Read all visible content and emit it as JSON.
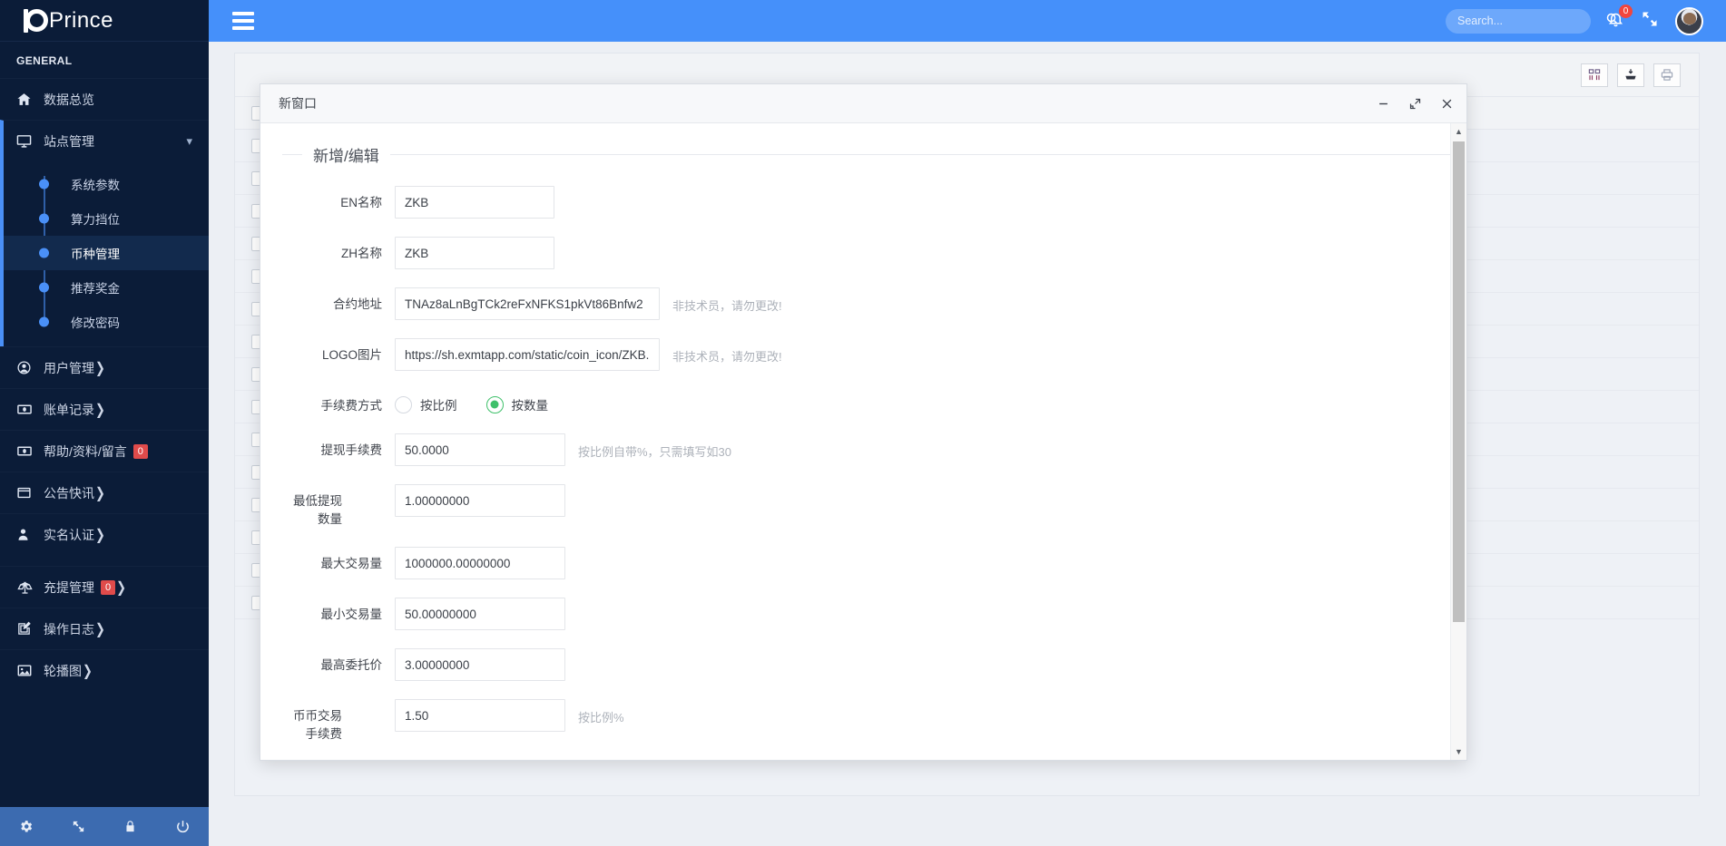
{
  "brand": {
    "name": "Prince",
    "logo_icon": "prince-logo-icon"
  },
  "sidebar": {
    "section_label": "GENERAL",
    "items": [
      {
        "label": "数据总览",
        "icon": "home-icon",
        "badge": null,
        "arrow": false
      },
      {
        "label": "站点管理",
        "icon": "monitor-icon",
        "badge": null,
        "arrow": false,
        "expanded": true
      },
      {
        "label": "用户管理",
        "icon": "user-circle-icon",
        "badge": null,
        "arrow": true
      },
      {
        "label": "账单记录",
        "icon": "banknote-icon",
        "badge": null,
        "arrow": true
      },
      {
        "label": "帮助/资料/留言",
        "icon": "banknote-icon",
        "badge": "0",
        "arrow": false
      },
      {
        "label": "公告快讯",
        "icon": "window-icon",
        "badge": null,
        "arrow": true
      },
      {
        "label": "实名认证",
        "icon": "person-icon",
        "badge": null,
        "arrow": true
      },
      {
        "label": "充提管理",
        "icon": "scales-icon",
        "badge": "0",
        "arrow": true
      },
      {
        "label": "操作日志",
        "icon": "edit-square-icon",
        "badge": null,
        "arrow": true
      },
      {
        "label": "轮播图",
        "icon": "image-icon",
        "badge": null,
        "arrow": true
      }
    ],
    "submenu": [
      {
        "label": "系统参数",
        "selected": false
      },
      {
        "label": "算力挡位",
        "selected": false
      },
      {
        "label": "币种管理",
        "selected": true
      },
      {
        "label": "推荐奖金",
        "selected": false
      },
      {
        "label": "修改密码",
        "selected": false
      }
    ],
    "footer_icons": [
      "gear-icon",
      "expand-icon",
      "lock-icon",
      "power-icon"
    ]
  },
  "topbar": {
    "menu_icon": "hamburger-icon",
    "search": {
      "placeholder": "Search...",
      "value": "",
      "icon": "search-icon"
    },
    "notifications": {
      "icon": "bell-icon",
      "count": "0"
    },
    "fullscreen_icon": "fullscreen-icon",
    "avatar_icon": "avatar"
  },
  "page": {
    "toolbar_buttons": [
      {
        "icon": "columns-icon"
      },
      {
        "icon": "export-icon"
      },
      {
        "icon": "print-icon"
      }
    ],
    "row_count": 15,
    "pager_prev_icon": "chevron-left-icon"
  },
  "modal": {
    "title": "新窗口",
    "controls": {
      "minimize_icon": "minimize-icon",
      "maximize_icon": "maximize-icon",
      "close_icon": "close-icon"
    },
    "legend": "新增/编辑",
    "fields": [
      {
        "label": "EN名称",
        "value": "ZKB",
        "hint": "",
        "width": "w-sm"
      },
      {
        "label": "ZH名称",
        "value": "ZKB",
        "hint": "",
        "width": "w-sm"
      },
      {
        "label": "合约地址",
        "value": "TNAz8aLnBgTCk2reFxNFKS1pkVt86Bnfw2",
        "hint": "非技术员，请勿更改!",
        "width": "w-lg"
      },
      {
        "label": "LOGO图片",
        "value": "https://sh.exmtapp.com/static/coin_icon/ZKB.png",
        "hint": "非技术员，请勿更改!",
        "width": "w-lg"
      }
    ],
    "fee_mode": {
      "label": "手续费方式",
      "options": [
        {
          "label": "按比例",
          "selected": false
        },
        {
          "label": "按数量",
          "selected": true
        }
      ]
    },
    "fields2": [
      {
        "label": "提现手续费",
        "value": "50.0000",
        "hint": "按比例自带%，只需填写如30",
        "width": "w-md"
      },
      {
        "label": "最低提现数量",
        "value": "1.00000000",
        "hint": "",
        "width": "w-md"
      },
      {
        "label": "最大交易量",
        "value": "1000000.00000000",
        "hint": "",
        "width": "w-md"
      },
      {
        "label": "最小交易量",
        "value": "50.00000000",
        "hint": "",
        "width": "w-md"
      },
      {
        "label": "最高委托价",
        "value": "3.00000000",
        "hint": "",
        "width": "w-md"
      },
      {
        "label": "币币交易手续费",
        "value": "1.50",
        "hint": "按比例%",
        "width": "w-md"
      }
    ],
    "scrollbar": {
      "up_icon": "caret-up-icon",
      "down_icon": "caret-down-icon"
    }
  },
  "colors": {
    "sidebar_bg": "#0b1c38",
    "topbar_blue": "#4590fa",
    "accent_blue": "#4a90f7",
    "badge_red": "#e04b4b",
    "radio_green": "#3fc06a",
    "page_bg": "#eceff4"
  }
}
